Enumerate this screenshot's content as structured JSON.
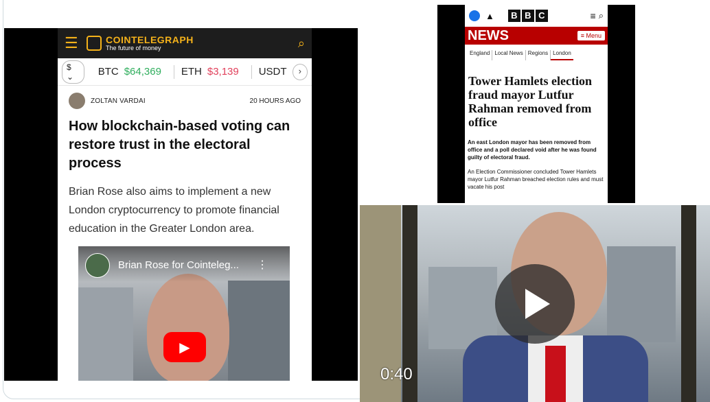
{
  "cointelegraph": {
    "brand": "COINTELEGRAPH",
    "tagline": "The future of money",
    "icons": {
      "menu": "hamburger-icon",
      "search": "search-icon"
    },
    "ticker": {
      "currency": "$",
      "items": [
        {
          "symbol": "BTC",
          "price": "$64,369"
        },
        {
          "symbol": "ETH",
          "price": "$3,139"
        },
        {
          "symbol": "USDT"
        }
      ]
    },
    "author": "ZOLTAN VARDAI",
    "time": "20 HOURS AGO",
    "headline": "How blockchain-based voting can restore trust in the electoral process",
    "lede": "Brian Rose also aims to implement a new London cryptocurrency to promote financial education in the Greater London area.",
    "video_title": "Brian Rose for Cointeleg...",
    "colors": {
      "accent": "#f5b21a",
      "up": "#2fae5d",
      "down": "#e1405b"
    }
  },
  "bbc": {
    "logo_letters": [
      "B",
      "B",
      "C"
    ],
    "section": "NEWS",
    "menu_label": "Menu",
    "nav": [
      "England",
      "Local News",
      "Regions",
      "London"
    ],
    "headline": "Tower Hamlets election fraud mayor Lutfur Rahman removed from office",
    "summary": "An east London mayor has been removed from office and a poll declared void after he was found guilty of electoral fraud.",
    "body": "An Election Commissioner concluded Tower Hamlets mayor Lutfur Rahman breached election rules and must vacate his post",
    "colors": {
      "brand": "#b80000"
    }
  },
  "video": {
    "duration": "0:40"
  }
}
